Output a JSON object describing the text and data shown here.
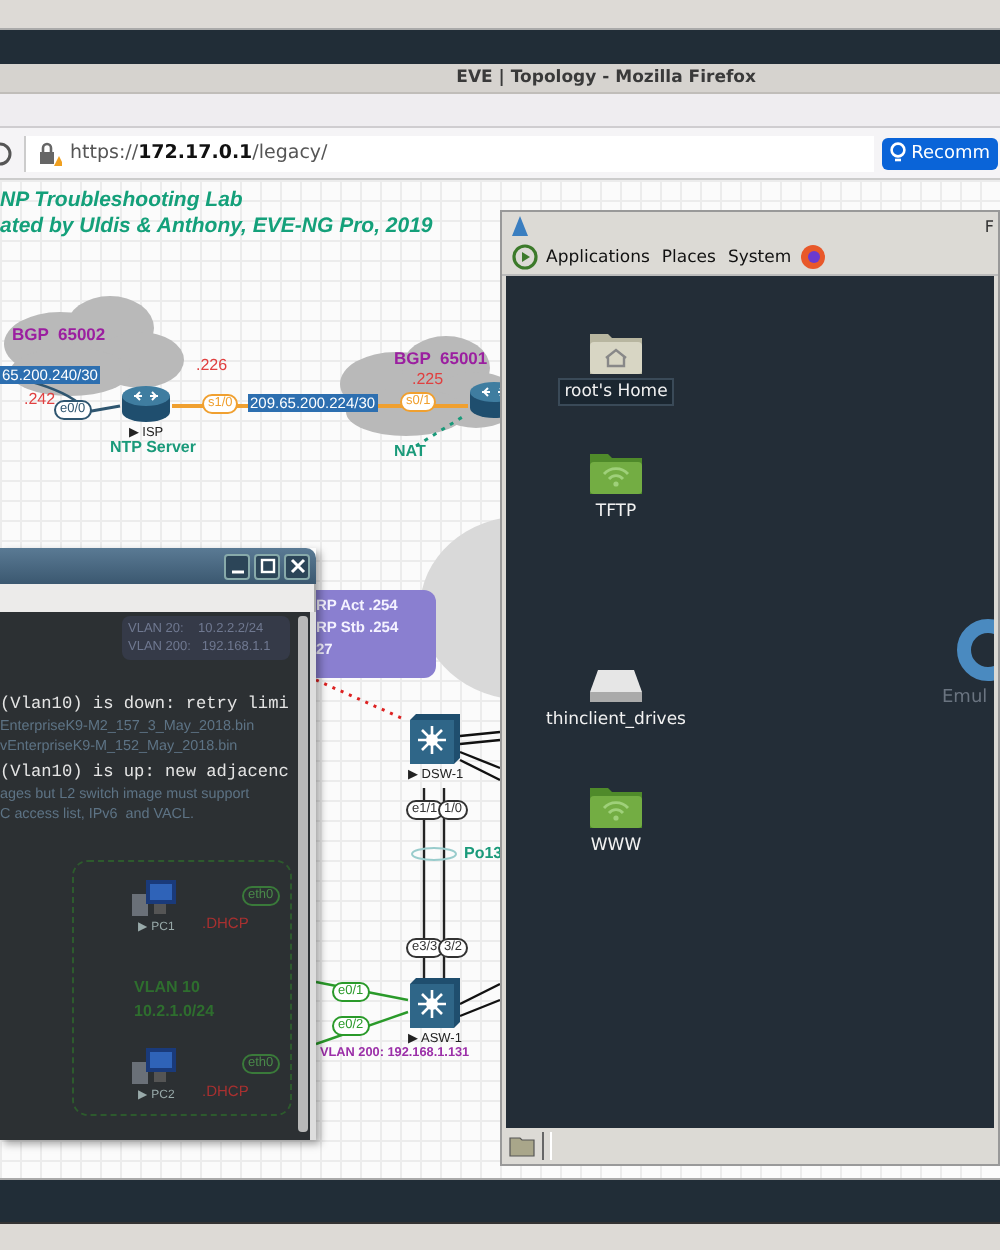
{
  "window": {
    "title": "EVE | Topology - Mozilla Firefox"
  },
  "address_bar": {
    "scheme": "https://",
    "host": "172.17.0.1",
    "path": "/legacy/",
    "button": "Recomm"
  },
  "topology": {
    "heading": [
      "NP Troubleshooting Lab",
      "ated by Uldis & Anthony, EVE-NG Pro, 2019"
    ],
    "clouds": [
      {
        "label": "BGP  65002"
      },
      {
        "label": "BGP  65001"
      }
    ],
    "subnets": [
      "65.200.240/30",
      "209.65.200.224/30"
    ],
    "addresses": [
      ".242",
      ".226",
      ".225"
    ],
    "nodes": [
      {
        "kind": "router",
        "name": "▶ ISP"
      },
      {
        "kind": "router"
      },
      {
        "kind": "switch",
        "name": "▶ DSW-1"
      },
      {
        "kind": "switch",
        "name": "▶ ASW-1"
      }
    ],
    "interfaces": [
      {
        "label": "e0/0",
        "color": "#2f5670"
      },
      {
        "label": "s1/0",
        "color": "#f0a030"
      },
      {
        "label": "s0/1",
        "color": "#f0a030"
      },
      {
        "label": "e1/1",
        "color": "#333333"
      },
      {
        "label": "1/0",
        "color": "#333333"
      },
      {
        "label": "e3/3",
        "color": "#333333"
      },
      {
        "label": "3/2",
        "color": "#333333"
      },
      {
        "label": "e0/1",
        "color": "#2a9a2a"
      },
      {
        "label": "e0/2",
        "color": "#2a9a2a"
      }
    ],
    "notes": [
      {
        "text": "NTP Server",
        "color": "#1a9a7a"
      },
      {
        "text": "NAT",
        "color": "#1a9a7a"
      },
      {
        "text": "Po13",
        "color": "#1a9a7a"
      },
      {
        "text": "VLAN 200: 192.168.1.131",
        "color": "#9b2fa8"
      }
    ],
    "hsrp_box": [
      "RP Act .254",
      "RP Stb .254",
      "27"
    ]
  },
  "terminal": {
    "behind_box": [
      "VLAN 20:    10.2.2.2/24",
      "VLAN 200:   192.168.1.1"
    ],
    "lines": [
      {
        "kind": "output",
        "text": "(Vlan10) is down: retry limi"
      },
      {
        "kind": "dim",
        "text": "EnterpriseK9-M2_157_3_May_2018.bin"
      },
      {
        "kind": "dim",
        "text": "vEnterpriseK9-M_152_May_2018.bin"
      },
      {
        "kind": "output",
        "text": "(Vlan10) is up: new adjacenc"
      },
      {
        "kind": "dim",
        "text": "ages but L2 switch image must support"
      },
      {
        "kind": "dim",
        "text": "C access list, IPv6  and VACL."
      }
    ],
    "vlan_box": {
      "title": "VLAN 10",
      "subnet": "10.2.1.0/24",
      "pcs": [
        {
          "name": "▶ PC1",
          "address": ".DHCP",
          "port": "eth0"
        },
        {
          "name": "▶ PC2",
          "address": ".DHCP",
          "port": "eth0"
        }
      ]
    }
  },
  "remote_desktop": {
    "title": "F",
    "menu": [
      "Applications",
      "Places",
      "System"
    ],
    "icons": [
      {
        "kind": "home-folder",
        "label": "root's Home",
        "selected": true
      },
      {
        "kind": "share-folder",
        "label": "TFTP",
        "selected": false
      },
      {
        "kind": "drive",
        "label": "thinclient_drives",
        "selected": false
      },
      {
        "kind": "share-folder",
        "label": "WWW",
        "selected": false
      }
    ],
    "logo_text": "Emul"
  }
}
